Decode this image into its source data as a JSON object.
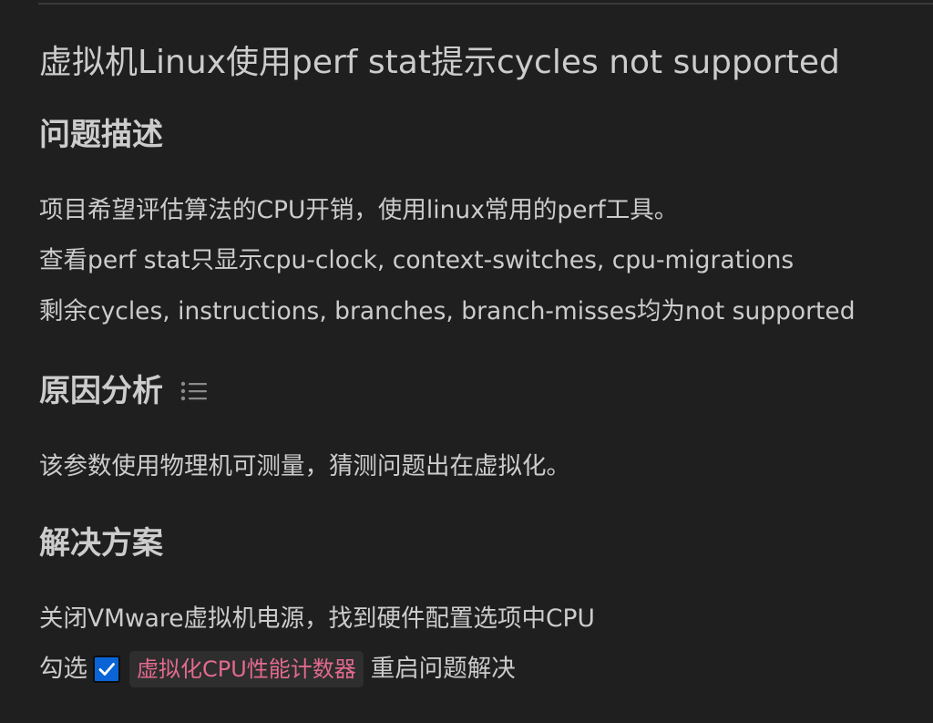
{
  "document": {
    "title": "虚拟机Linux使用perf stat提示cycles not supported",
    "sections": {
      "problem": {
        "heading": "问题描述",
        "lines": [
          "项目希望评估算法的CPU开销，使用linux常用的perf工具。",
          "查看perf stat只显示cpu-clock, context-switches, cpu-migrations",
          "剩余cycles, instructions, branches, branch-misses均为not supported"
        ]
      },
      "cause": {
        "heading": "原因分析",
        "outline_icon": "list-icon",
        "lines": [
          "该参数使用物理机可测量，猜测问题出在虚拟化。"
        ]
      },
      "solution": {
        "heading": "解决方案",
        "line1": "关闭VMware虚拟机电源，找到硬件配置选项中CPU",
        "line2_prefix": "勾选",
        "checkbox_icon": "checkmark-icon",
        "checkbox_checked": true,
        "code": "虚拟化CPU性能计数器",
        "line2_suffix": "重启问题解决"
      }
    }
  },
  "colors": {
    "background": "#1f1f1f",
    "text": "#cccccc",
    "code_text": "#e26a8f",
    "code_background": "#2e2e2e",
    "checkbox": "#0a64d6"
  }
}
